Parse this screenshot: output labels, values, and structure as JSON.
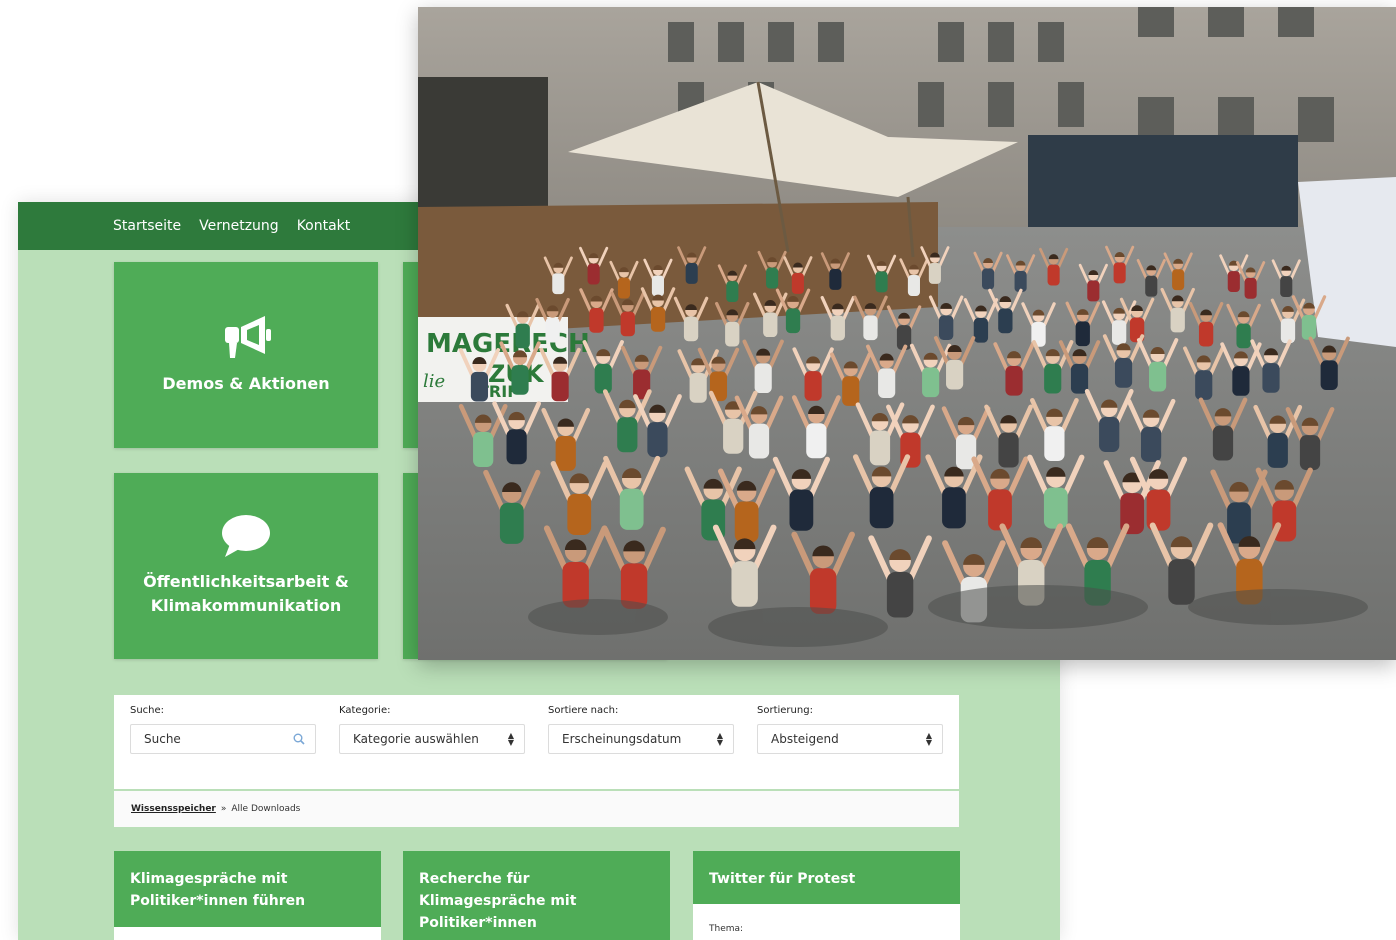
{
  "nav": {
    "items": [
      {
        "label": "Startseite"
      },
      {
        "label": "Vernetzung"
      },
      {
        "label": "Kontakt"
      }
    ]
  },
  "tiles": [
    {
      "label": "Demos & Aktionen",
      "icon": "megaphone-icon"
    },
    {
      "label_line1": "Öffentlichkeitsarbeit &",
      "label_line2": "Klimakommunikation",
      "icon": "speech-bubble-icon"
    }
  ],
  "filters": {
    "search": {
      "label": "Suche:",
      "placeholder": "Suche"
    },
    "category": {
      "label": "Kategorie:",
      "value": "Kategorie auswählen"
    },
    "sortby": {
      "label": "Sortiere nach:",
      "value": "Erscheinungsdatum"
    },
    "order": {
      "label": "Sortierung:",
      "value": "Absteigend"
    }
  },
  "breadcrumb": {
    "root": "Wissensspeicher",
    "separator": "»",
    "current": "Alle Downloads"
  },
  "cards": [
    {
      "title_line1": "Klimagespräche mit",
      "title_line2": "Politiker*innen führen"
    },
    {
      "title_line1": "Recherche für",
      "title_line2": "Klimagespräche mit",
      "title_line3": "Politiker*innen"
    },
    {
      "title": "Twitter für Protest",
      "meta": "Thema:"
    }
  ],
  "photo_banner": {
    "line1": "MAGERECH",
    "line2": "ZUK",
    "line3": "lie",
    "line4": "TRIF"
  },
  "colors": {
    "nav_green": "#2e7a3c",
    "tile_green": "#4fac57",
    "page_bg": "#badfb8"
  }
}
